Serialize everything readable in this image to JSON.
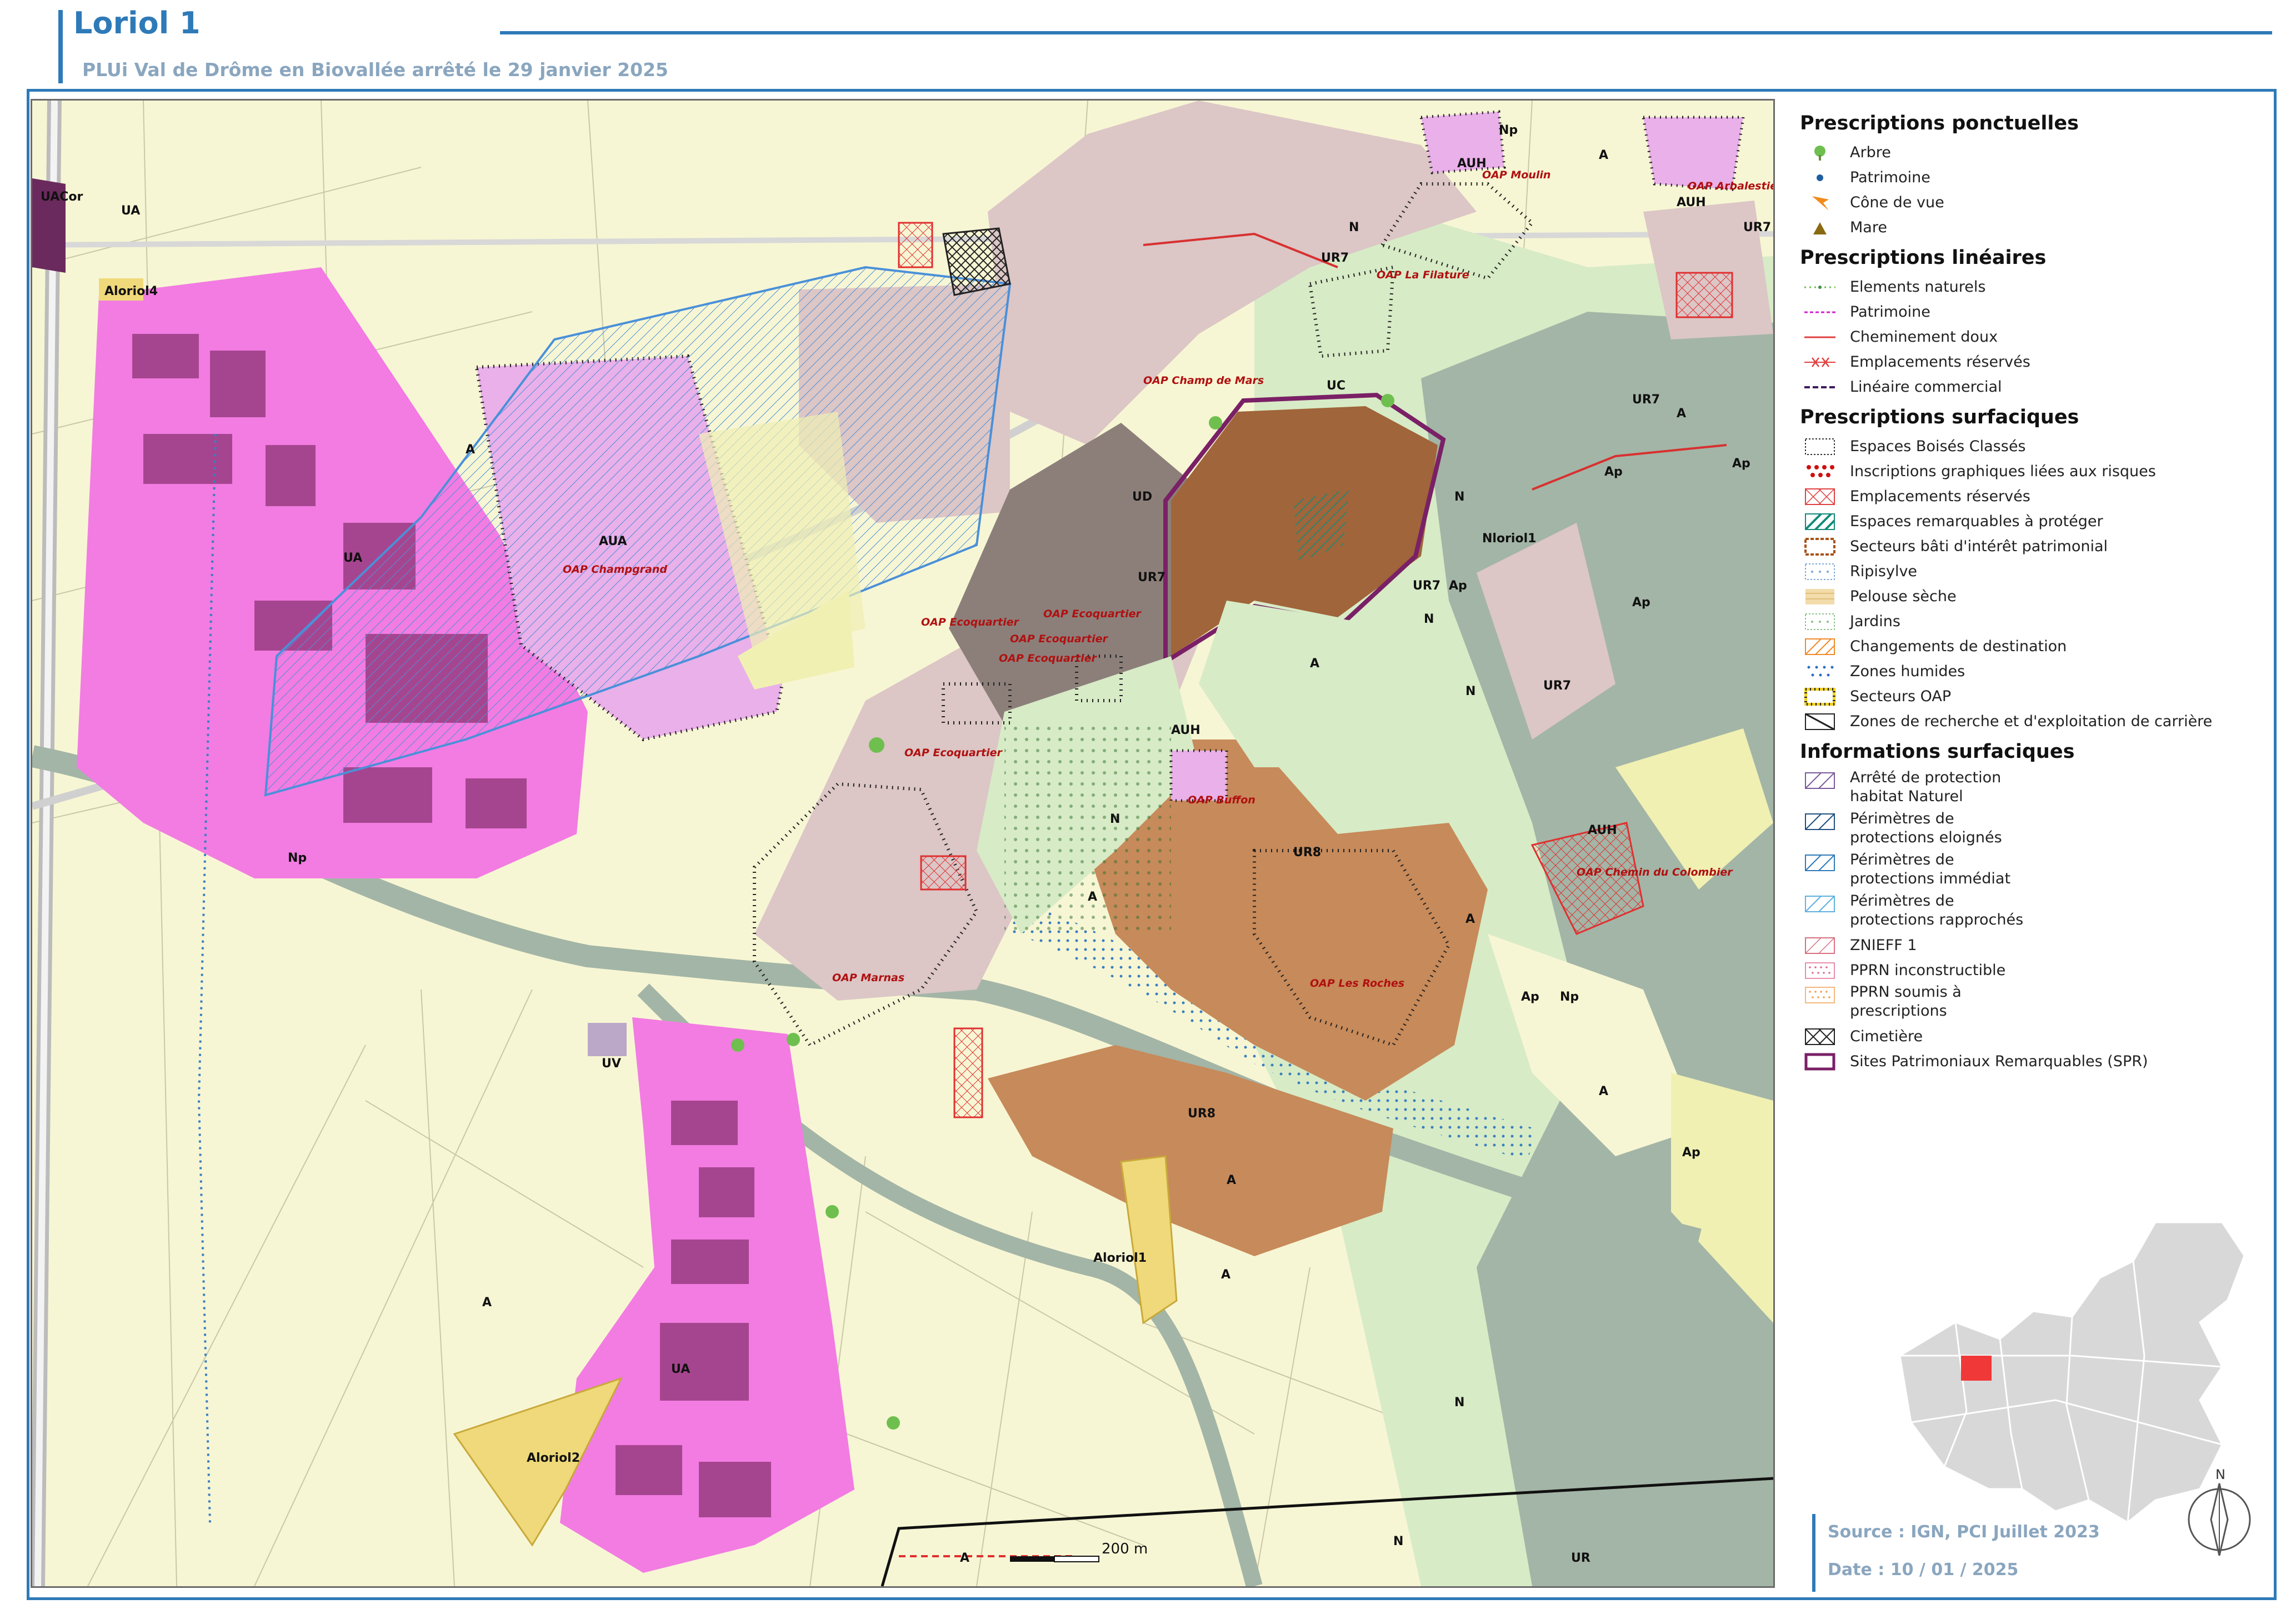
{
  "header": {
    "title": "Loriol 1",
    "subtitle": "PLUi Val de Drôme en Biovallée arrêté le 29 janvier 2025"
  },
  "colors": {
    "accent": "#2e7ab8",
    "muted_text": "#8aa6bf",
    "zone_A": "#f7f6d4",
    "zone_UA": "#f27ce2",
    "zone_UC": "#a0653a",
    "zone_UR8": "#c78a5a",
    "zone_UD": "#8c7f7a",
    "zone_UR7": "#dcc6c6",
    "zone_N": "#d7ebc6",
    "zone_Np": "#a3b5a6",
    "zone_AU": "#e9b0e9",
    "zone_Ap": "#f0f0b3"
  },
  "map": {
    "zone_labels": [
      {
        "text": "UACor"
      },
      {
        "text": "Aloriol4"
      },
      {
        "text": "UA"
      },
      {
        "text": "UA"
      },
      {
        "text": "UR7"
      },
      {
        "text": "AUH"
      },
      {
        "text": "Np"
      },
      {
        "text": "AUH"
      },
      {
        "text": "UR7"
      },
      {
        "text": "N"
      },
      {
        "text": "A"
      },
      {
        "text": "UC"
      },
      {
        "text": "UD"
      },
      {
        "text": "UR7"
      },
      {
        "text": "Ap"
      },
      {
        "text": "AUA"
      },
      {
        "text": "A"
      },
      {
        "text": "A"
      },
      {
        "text": "UR7"
      },
      {
        "text": "N"
      },
      {
        "text": "Ap"
      },
      {
        "text": "Ap"
      },
      {
        "text": "Nloriol1"
      },
      {
        "text": "UR7"
      },
      {
        "text": "Ap"
      },
      {
        "text": "N"
      },
      {
        "text": "N"
      },
      {
        "text": "A"
      },
      {
        "text": "AUH"
      },
      {
        "text": "N"
      },
      {
        "text": "UR8"
      },
      {
        "text": "AUH"
      },
      {
        "text": "UR7"
      },
      {
        "text": "A"
      },
      {
        "text": "Np"
      },
      {
        "text": "A"
      },
      {
        "text": "UV"
      },
      {
        "text": "Ap"
      },
      {
        "text": "Np"
      },
      {
        "text": "UR8"
      },
      {
        "text": "A"
      },
      {
        "text": "Aloriol1"
      },
      {
        "text": "A"
      },
      {
        "text": "UA"
      },
      {
        "text": "Aloriol2"
      },
      {
        "text": "A"
      },
      {
        "text": "Ap"
      },
      {
        "text": "A"
      },
      {
        "text": "N"
      },
      {
        "text": "A"
      },
      {
        "text": "UR"
      },
      {
        "text": "N"
      }
    ],
    "oap_labels": [
      {
        "text": "OAP Moulin"
      },
      {
        "text": "OAP Arbalestier"
      },
      {
        "text": "OAP La Filature"
      },
      {
        "text": "OAP Champ de Mars"
      },
      {
        "text": "OAP Champgrand"
      },
      {
        "text": "OAP Ecoquartier"
      },
      {
        "text": "OAP Ecoquartier"
      },
      {
        "text": "OAP Ecoquartier"
      },
      {
        "text": "OAP Ecoquartier"
      },
      {
        "text": "OAP Ecoquartier"
      },
      {
        "text": "OAP Buffon"
      },
      {
        "text": "OAP Chemin du Colombier"
      },
      {
        "text": "OAP Les Roches"
      },
      {
        "text": "OAP Marnas"
      }
    ],
    "scale_label": "200 m"
  },
  "legend": {
    "sections": [
      {
        "title": "Prescriptions ponctuelles",
        "items": [
          {
            "label": "Arbre",
            "icon": "tree-icon"
          },
          {
            "label": "Patrimoine",
            "icon": "dot-icon"
          },
          {
            "label": "Cône de vue",
            "icon": "view-cone-icon"
          },
          {
            "label": "Mare",
            "icon": "triangle-icon"
          }
        ]
      },
      {
        "title": "Prescriptions linéaires",
        "items": [
          {
            "label": "Elements naturels",
            "icon": "green-dotted-line-icon"
          },
          {
            "label": "Patrimoine",
            "icon": "magenta-dashed-line-icon"
          },
          {
            "label": "Cheminement doux",
            "icon": "red-line-icon"
          },
          {
            "label": "Emplacements réservés",
            "icon": "red-cross-line-icon"
          },
          {
            "label": "Linéaire commercial",
            "icon": "purple-dashed-line-icon"
          }
        ]
      },
      {
        "title": "Prescriptions surfaciques",
        "items": [
          {
            "label": "Espaces Boisés Classés",
            "icon": "ebc-icon"
          },
          {
            "label": "Inscriptions graphiques liées aux risques",
            "icon": "red-dots-icon"
          },
          {
            "label": "Emplacements réservés",
            "icon": "red-hatch-icon"
          },
          {
            "label": "Espaces remarquables à protéger",
            "icon": "teal-hatch-icon"
          },
          {
            "label": "Secteurs bâti d'intérêt patrimonial",
            "icon": "brown-dashed-box-icon"
          },
          {
            "label": "Ripisylve",
            "icon": "blue-dots-box-icon"
          },
          {
            "label": "Pelouse sèche",
            "icon": "tan-pattern-icon"
          },
          {
            "label": "Jardins",
            "icon": "green-dots-box-icon"
          },
          {
            "label": "Changements de destination",
            "icon": "orange-hatch-icon"
          },
          {
            "label": "Zones humides",
            "icon": "blue-dot-pattern-icon"
          },
          {
            "label": "Secteurs OAP",
            "icon": "yellow-dotted-box-icon"
          },
          {
            "label": "Zones de recherche et d'exploitation de carrière",
            "icon": "black-hatch-icon"
          }
        ]
      },
      {
        "title": "Informations surfaciques",
        "items": [
          {
            "label": "Arrêté de protection habitat Naturel",
            "icon": "purple-hatch-icon",
            "lines": [
              "Arrêté de protection",
              "habitat Naturel"
            ]
          },
          {
            "label": "Périmètres de protections eloignés",
            "icon": "dark-blue-hatch-icon",
            "lines": [
              "Périmètres de",
              "protections eloignés"
            ]
          },
          {
            "label": "Périmètres de protections immédiat",
            "icon": "blue-hatch-icon",
            "lines": [
              "Périmètres de",
              "protections immédiat"
            ]
          },
          {
            "label": "Périmètres de protections rapprochés",
            "icon": "light-blue-hatch-icon",
            "lines": [
              "Périmètres de",
              "protections rapprochés"
            ]
          },
          {
            "label": "ZNIEFF 1",
            "icon": "pink-hatch-icon"
          },
          {
            "label": "PPRN inconstructible",
            "icon": "pink-dots-icon"
          },
          {
            "label": "PPRN soumis à prescriptions",
            "icon": "orange-dots-icon",
            "lines": [
              "PPRN soumis à",
              "prescriptions"
            ]
          },
          {
            "label": "Cimetière",
            "icon": "crosshatch-icon"
          },
          {
            "label": "Sites Patrimoniaux Remarquables (SPR)",
            "icon": "purple-outline-icon"
          }
        ]
      }
    ]
  },
  "footer": {
    "source": "Source : IGN, PCI Juillet 2023",
    "date": "Date : 10 / 01 / 2025"
  },
  "north_arrow": {
    "label": "N"
  }
}
